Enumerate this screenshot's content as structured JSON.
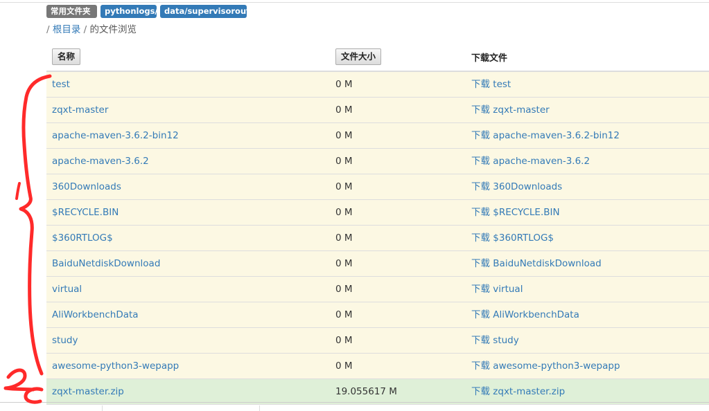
{
  "badges": [
    "常用文件夹",
    "pythonlogs/",
    "data/supervisorout/"
  ],
  "breadcrumb": {
    "sep1": "/",
    "root": "根目录",
    "sep2": "/",
    "tail": "的文件浏览"
  },
  "table": {
    "headers": {
      "name": "名称",
      "size": "文件大小",
      "download": "下载文件"
    },
    "rows": [
      {
        "name": "test",
        "size": "0 M",
        "download": "下载 test"
      },
      {
        "name": "zqxt-master",
        "size": "0 M",
        "download": "下载 zqxt-master"
      },
      {
        "name": "apache-maven-3.6.2-bin12",
        "size": "0 M",
        "download": "下载 apache-maven-3.6.2-bin12"
      },
      {
        "name": "apache-maven-3.6.2",
        "size": "0 M",
        "download": "下载 apache-maven-3.6.2"
      },
      {
        "name": "360Downloads",
        "size": "0 M",
        "download": "下载 360Downloads"
      },
      {
        "name": "$RECYCLE.BIN",
        "size": "0 M",
        "download": "下载 $RECYCLE.BIN"
      },
      {
        "name": "$360RTLOG$",
        "size": "0 M",
        "download": "下载 $360RTLOG$"
      },
      {
        "name": "BaiduNetdiskDownload",
        "size": "0 M",
        "download": "下载 BaiduNetdiskDownload"
      },
      {
        "name": "virtual",
        "size": "0 M",
        "download": "下载 virtual"
      },
      {
        "name": "AliWorkbenchData",
        "size": "0 M",
        "download": "下载 AliWorkbenchData"
      },
      {
        "name": "study",
        "size": "0 M",
        "download": "下载 study"
      },
      {
        "name": "awesome-python3-wepapp",
        "size": "0 M",
        "download": "下载 awesome-python3-wepapp"
      },
      {
        "name": "zqxt-master.zip",
        "size": "19.055617 M",
        "download": "下载 zqxt-master.zip"
      }
    ]
  },
  "annotations": {
    "color": "#ff2a2a",
    "labels": [
      "1",
      "2"
    ]
  },
  "colors": {
    "link": "#337ab7",
    "folder_row": "#fcf8e3",
    "file_row": "#dff0d8",
    "badge_gray": "#777777",
    "badge_blue": "#337ab7"
  }
}
